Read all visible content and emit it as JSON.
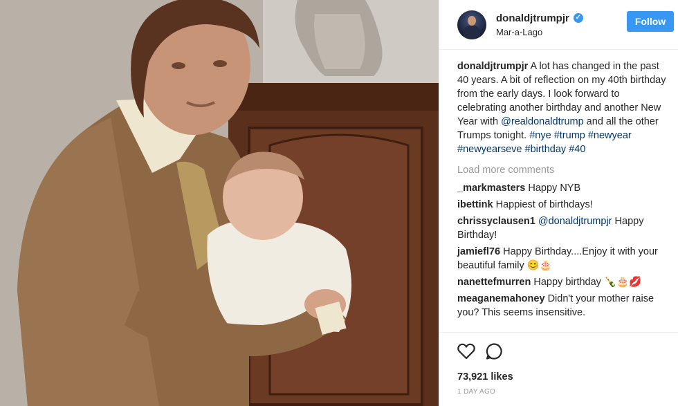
{
  "post": {
    "username": "donaldjtrumpjr",
    "location": "Mar-a-Lago",
    "follow_label": "Follow",
    "caption": {
      "author": "donaldjtrumpjr",
      "text_1": "A lot has changed in the past 40 years. A bit of reflection on my 40th birthday from the early days. I look forward to celebrating another birthday and another New Year with ",
      "mention": "@realdonaldtrump",
      "text_2": " and all the other Trumps tonight. ",
      "hashtags": "#nye #trump #newyear #newyearseve #birthday #40"
    },
    "load_more": "Load more comments",
    "comments": [
      {
        "user": "_markmasters",
        "text": "Happy NYB"
      },
      {
        "user": "ibettink",
        "text": "Happiest of birthdays!"
      },
      {
        "user": "chrissyclausen1",
        "mention": "@donaldjtrumpjr",
        "text": " Happy Birthday!"
      },
      {
        "user": "jamiefl76",
        "text": "Happy Birthday....Enjoy it with your beautiful family 😊🎂"
      },
      {
        "user": "nanettefmurren",
        "text": "Happy birthday 🍾🎂💋"
      },
      {
        "user": "meaganemahoney",
        "text": "Didn't your mother raise you? This seems insensitive."
      }
    ],
    "likes": "73,921 likes",
    "time": "1 DAY AGO"
  },
  "icons": {
    "verified": "verified-badge-icon",
    "like": "heart-icon",
    "comment": "comment-bubble-icon"
  },
  "colors": {
    "accent": "#3897f0",
    "link": "#003569",
    "muted": "#999999"
  }
}
